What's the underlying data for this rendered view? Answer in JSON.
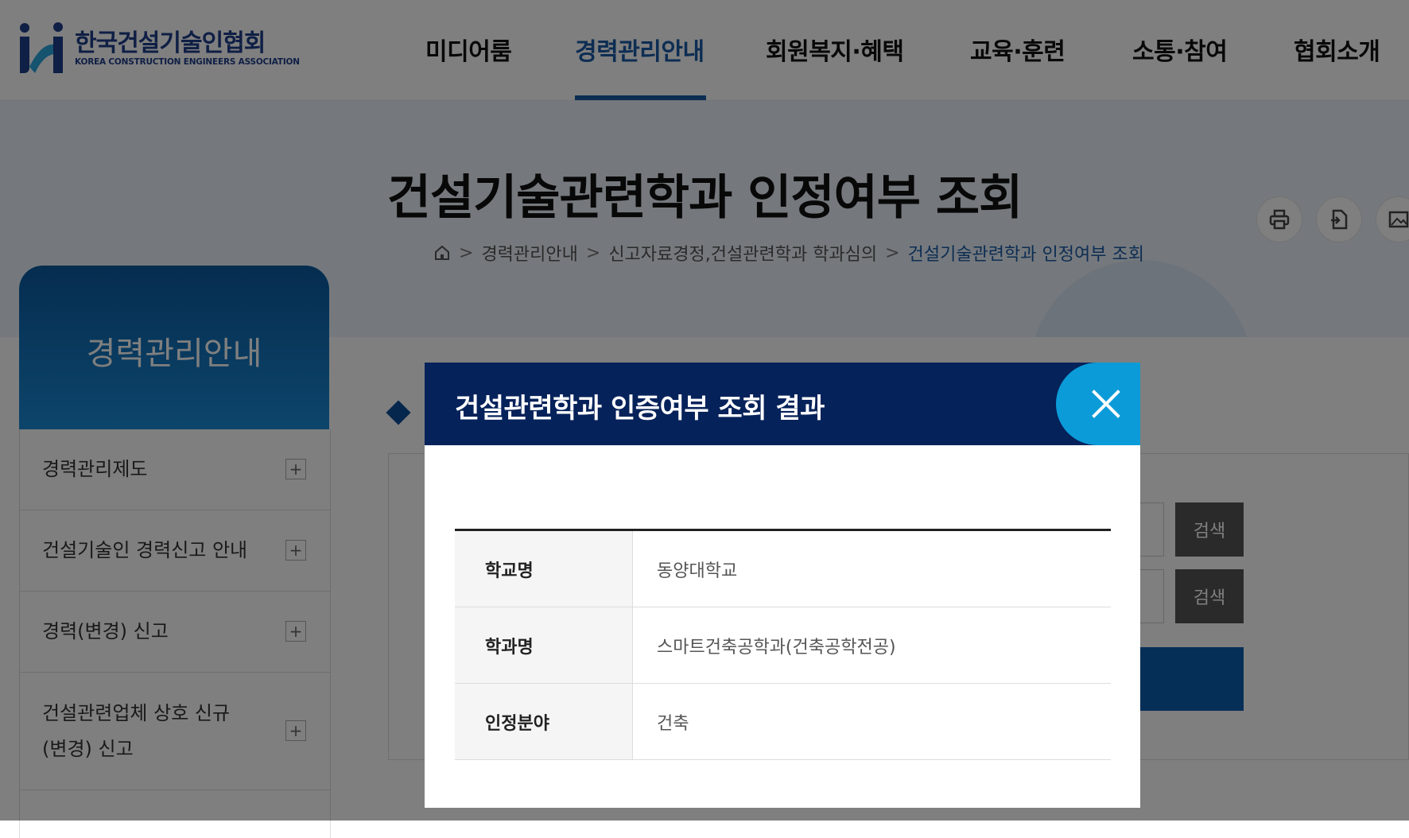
{
  "header": {
    "logo_ko": "한국건설기술인협회",
    "logo_en": "KOREA CONSTRUCTION ENGINEERS ASSOCIATION",
    "nav": [
      {
        "label": "미디어룸"
      },
      {
        "label": "경력관리안내"
      },
      {
        "label": "회원복지·혜택"
      },
      {
        "label": "교육·훈련"
      },
      {
        "label": "소통·참여"
      },
      {
        "label": "협회소개"
      }
    ],
    "active_nav": "경력관리안내"
  },
  "visual": {
    "title": "건설기술관련학과 인정여부 조회",
    "breadcrumb": [
      "경력관리안내",
      "신고자료경정,건설관련학과 학과심의",
      "건설기술관련학과 인정여부 조회"
    ],
    "utility_icons": [
      "print-icon",
      "document-icon",
      "image-icon"
    ]
  },
  "sidebar": {
    "title": "경력관리안내",
    "items": [
      {
        "label": "경력관리제도"
      },
      {
        "label": "건설기술인 경력신고 안내"
      },
      {
        "label": "경력(변경) 신고"
      },
      {
        "label": "건설관련업체 상호 신규 (변경) 신고"
      }
    ]
  },
  "main": {
    "search_button": "검색"
  },
  "modal": {
    "title": "건설관련학과 인증여부 조회 결과",
    "rows": [
      {
        "label": "학교명",
        "value": "동양대학교"
      },
      {
        "label": "학과명",
        "value": "스마트건축공학과(건축공학전공)"
      },
      {
        "label": "인정분야",
        "value": "건축"
      }
    ]
  },
  "colors": {
    "brand_blue": "#1a5ba6",
    "modal_header": "#06225a",
    "close_button": "#0b9bd8"
  }
}
